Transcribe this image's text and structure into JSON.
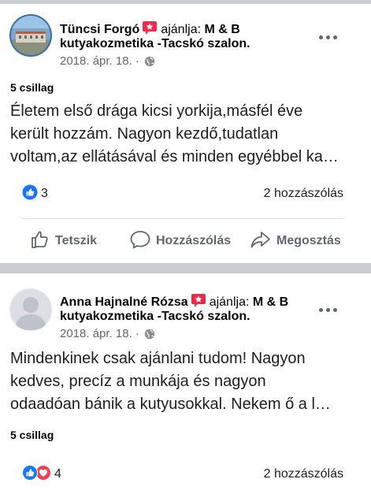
{
  "posts": [
    {
      "author": "Tüncsi Forgó",
      "recommends_label": "ajánlja:",
      "page_line1": "M & B",
      "page_line2": "kutyakozmetika -Tacskó szalon.",
      "date": "2018. ápr. 18. ·",
      "stars": "5 csillag",
      "text_lines": [
        "Életem első  drága kicsi yorkija,másfél éve",
        "került hozzám. Nagyon kezdő,tudatlan",
        "voltam,az ellátásával és minden egyébbel ka…"
      ],
      "reaction_count": "3",
      "comments": "2 hozzászólás",
      "actions": {
        "like": "Tetszik",
        "comment": "Hozzászólás",
        "share": "Megosztás"
      }
    },
    {
      "author": "Anna Hajnalné Rózsa",
      "recommends_label": "ajánlja:",
      "page_line1": "M & B",
      "page_line2": "kutyakozmetika -Tacskó szalon.",
      "date": "2018. ápr. 18. ·",
      "stars": "5 csillag",
      "text_lines": [
        "Mindenkinek csak ajánlani tudom! Nagyon",
        "kedves, precíz a munkája és nagyon",
        "odaadóan bánik a kutyusokkal. Nekem ő a l…"
      ],
      "reaction_count": "4",
      "comments": "2 hozzászólás"
    }
  ],
  "colors": {
    "like_blue": "#1877f2",
    "love_red": "#f33e58",
    "recommend_red": "#f0284a",
    "meta_gray": "#65676b"
  },
  "icons": [
    "recommend-icon",
    "globe-icon",
    "more-icon",
    "like-reaction-icon",
    "love-reaction-icon",
    "thumb-up-icon",
    "comment-icon",
    "share-icon"
  ]
}
